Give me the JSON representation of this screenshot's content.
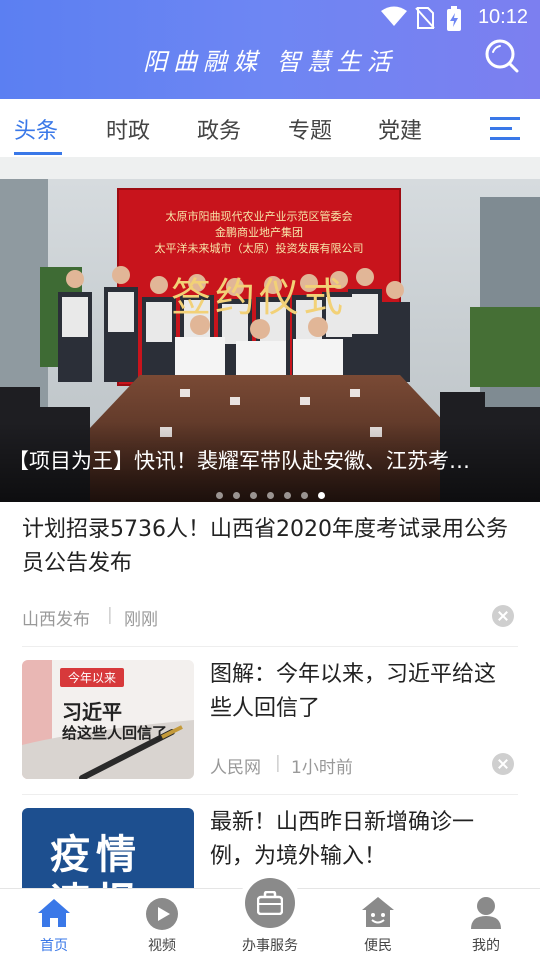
{
  "status_bar": {
    "time": "10:12"
  },
  "header": {
    "slogan": "阳曲融媒  智慧生活"
  },
  "tabs": [
    {
      "label": "头条",
      "active": true
    },
    {
      "label": "时政"
    },
    {
      "label": "政务"
    },
    {
      "label": "专题"
    },
    {
      "label": "党建"
    }
  ],
  "banner": {
    "backdrop_line1": "太原市阳曲现代农业产业示范区管委会",
    "backdrop_line2": "金鹏商业地产集团",
    "backdrop_line3": "太平洋未来城市（太原）投资发展有限公司",
    "backdrop_big": "签约仪式",
    "caption": "【项目为王】快讯！裴耀军带队赴安徽、江苏考…",
    "dot_count": 7,
    "active_dot": 6
  },
  "news": [
    {
      "title": "计划招录5736人！山西省2020年度考试录用公务员公告发布",
      "source": "山西发布",
      "time": "刚刚"
    },
    {
      "title": "图解：今年以来，习近平给这些人回信了",
      "source": "人民网",
      "time": "1小时前",
      "thumb_tag": "今年以来",
      "thumb_line1": "习近平",
      "thumb_line2": "给这些人回信了"
    },
    {
      "title": "最新！山西昨日新增确诊一例，为境外输入！",
      "thumb_line1": "疫情",
      "thumb_line2": "速报"
    }
  ],
  "bottom_nav": [
    {
      "label": "首页",
      "active": true
    },
    {
      "label": "视频"
    },
    {
      "label": "办事服务"
    },
    {
      "label": "便民"
    },
    {
      "label": "我的"
    }
  ],
  "colors": {
    "accent": "#3a78e8",
    "header_start": "#5b7ff2",
    "header_end": "#7c7ff0"
  }
}
